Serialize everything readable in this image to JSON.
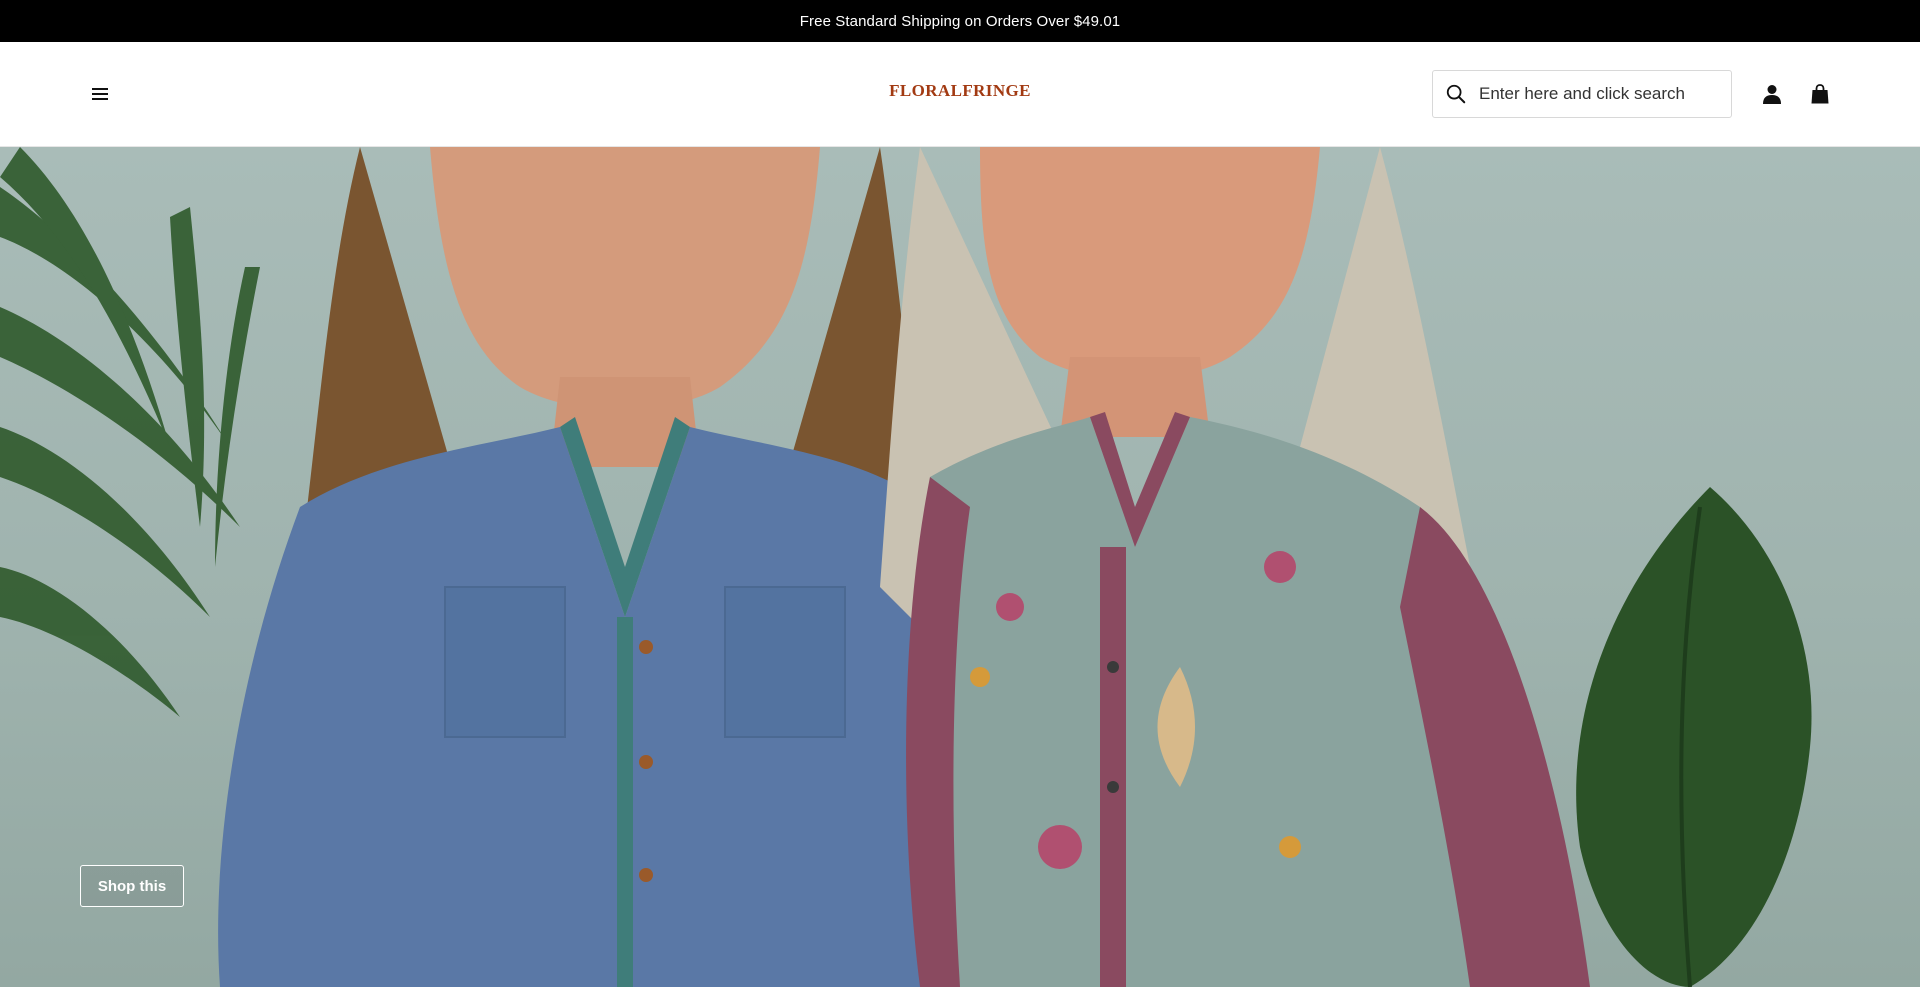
{
  "announcement": {
    "text": "Free Standard Shipping on Orders Over $49.01"
  },
  "header": {
    "menu_icon": "hamburger-menu-icon",
    "logo_text": "FLORALFRINGE",
    "search": {
      "placeholder": "Enter here and click search",
      "value": "",
      "icon": "search-icon"
    },
    "account_icon": "user-icon",
    "cart_icon": "shopping-bag-icon"
  },
  "hero": {
    "image": "two-women-in-linen-shirts-photo",
    "cta_label": "Shop this"
  },
  "colors": {
    "announce_bg": "#000000",
    "announce_text": "#ffffff",
    "logo": "#a23a12",
    "hero_wall": "#a9bcb8",
    "cta_border": "#ffffff"
  }
}
